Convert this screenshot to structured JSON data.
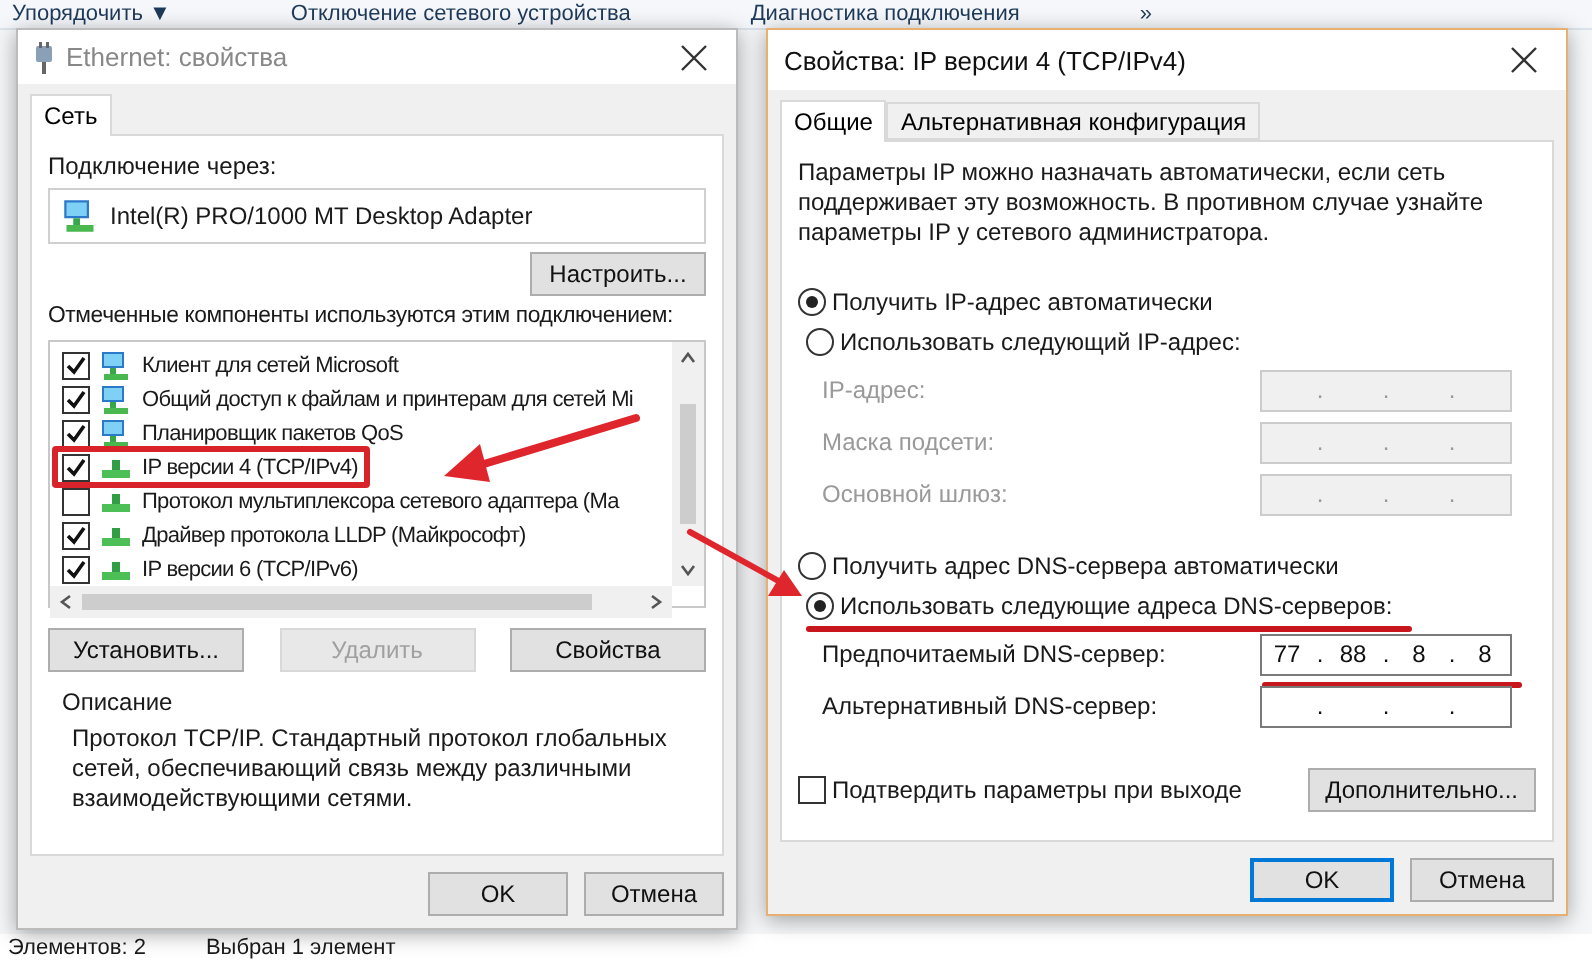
{
  "explorer": {
    "toolbar": [
      "Упорядочить ▼",
      "Отключение сетевого устройства",
      "Диагностика подключения",
      "»"
    ],
    "status_bar": [
      "Элементов: 2",
      "Выбран 1 элемент"
    ]
  },
  "ethernet_dialog": {
    "title": "Ethernet: свойства",
    "tabs": [
      {
        "label": "Сеть",
        "selected": true
      }
    ],
    "connect_label": "Подключение через:",
    "adapter": "Intel(R) PRO/1000 MT Desktop Adapter",
    "configure_button": "Настроить...",
    "components_label": "Отмеченные компоненты используются этим подключением:",
    "components": [
      {
        "kind": "client",
        "label": "Клиент для сетей Microsoft",
        "checked": true,
        "highlighted": false
      },
      {
        "kind": "service",
        "label": "Общий доступ к файлам и принтерам для сетей Mi",
        "checked": true,
        "highlighted": false
      },
      {
        "kind": "service",
        "label": "Планировщик пакетов QoS",
        "checked": true,
        "highlighted": false
      },
      {
        "kind": "protocol",
        "label": "IP версии 4 (TCP/IPv4)",
        "checked": true,
        "highlighted": true
      },
      {
        "kind": "protocol",
        "label": "Протокол мультиплексора сетевого адаптера (Ма",
        "checked": false,
        "highlighted": false
      },
      {
        "kind": "protocol",
        "label": "Драйвер протокола LLDP (Майкрософт)",
        "checked": true,
        "highlighted": false
      },
      {
        "kind": "protocol",
        "label": "IP версии 6 (TCP/IPv6)",
        "checked": true,
        "highlighted": false
      }
    ],
    "action_buttons": [
      {
        "label": "Установить...",
        "disabled": false
      },
      {
        "label": "Удалить",
        "disabled": true
      },
      {
        "label": "Свойства",
        "disabled": false
      }
    ],
    "description": {
      "title": "Описание",
      "text": "Протокол TCP/IP. Стандартный протокол глобальных сетей, обеспечивающий связь между различными взаимодействующими сетями."
    },
    "buttons": [
      {
        "label": "OK",
        "default": false
      },
      {
        "label": "Отмена",
        "default": false
      }
    ]
  },
  "ipv4_dialog": {
    "title": "Свойства: IP версии 4 (TCP/IPv4)",
    "tabs": [
      {
        "label": "Общие",
        "selected": true
      },
      {
        "label": "Альтернативная конфигурация",
        "selected": false
      }
    ],
    "intro": "Параметры IP можно назначать автоматически, если сеть поддерживает эту возможность. В противном случае узнайте параметры IP у сетевого администратора.",
    "ip_options": [
      {
        "label": "Получить IP-адрес автоматически",
        "selected": true,
        "underlined": false
      },
      {
        "label": "Использовать следующий IP-адрес:",
        "selected": false,
        "underlined": false
      }
    ],
    "ip_fields": [
      {
        "label": "IP-адрес:",
        "disabled": true,
        "separators": [
          ".",
          ".",
          "."
        ]
      },
      {
        "label": "Маска подсети:",
        "disabled": true,
        "separators": [
          ".",
          ".",
          "."
        ]
      },
      {
        "label": "Основной шлюз:",
        "disabled": true,
        "separators": [
          ".",
          ".",
          "."
        ]
      }
    ],
    "dns_options": [
      {
        "label": "Получить адрес DNS-сервера автоматически",
        "selected": false,
        "underlined": false
      },
      {
        "label": "Использовать следующие адреса DNS-серверов:",
        "selected": true,
        "underlined": true
      }
    ],
    "dns_fields": [
      {
        "label": "Предпочитаемый DNS-сервер:",
        "disabled": false,
        "underlined": true,
        "octets": [
          "77",
          "88",
          "8",
          "8"
        ],
        "separators": [
          ".",
          ".",
          "."
        ]
      },
      {
        "label": "Альтернативный DNS-сервер:",
        "disabled": false,
        "underlined": false,
        "separators": [
          ".",
          ".",
          "."
        ]
      }
    ],
    "validate": {
      "label": "Подтвердить параметры при выходе",
      "checked": false
    },
    "advanced_button": "Дополнительно...",
    "buttons": [
      {
        "label": "OK",
        "default": true
      },
      {
        "label": "Отмена",
        "default": false
      }
    ]
  }
}
